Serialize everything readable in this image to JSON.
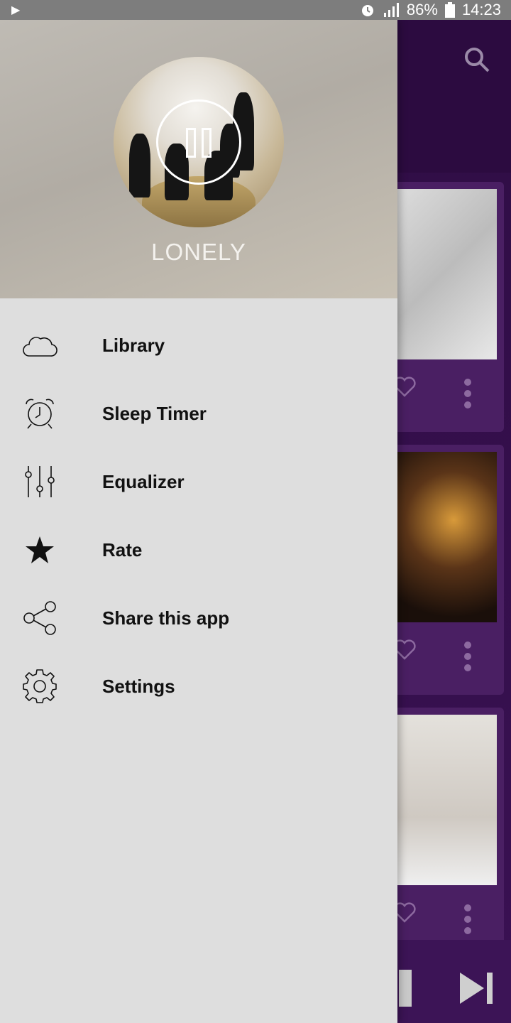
{
  "status_bar": {
    "battery": "86%",
    "time": "14:23"
  },
  "drawer": {
    "now_playing_title": "LONELY",
    "menu": [
      {
        "label": "Library",
        "icon": "cloud-icon"
      },
      {
        "label": "Sleep Timer",
        "icon": "alarm-clock-icon"
      },
      {
        "label": "Equalizer",
        "icon": "equalizer-icon"
      },
      {
        "label": "Rate",
        "icon": "star-icon"
      },
      {
        "label": "Share this app",
        "icon": "share-icon"
      },
      {
        "label": "Settings",
        "icon": "gear-icon"
      }
    ]
  },
  "colors": {
    "drawer_bg": "#dedede",
    "app_bg": "#3a1150",
    "status_bar": "#7d7d7d"
  }
}
